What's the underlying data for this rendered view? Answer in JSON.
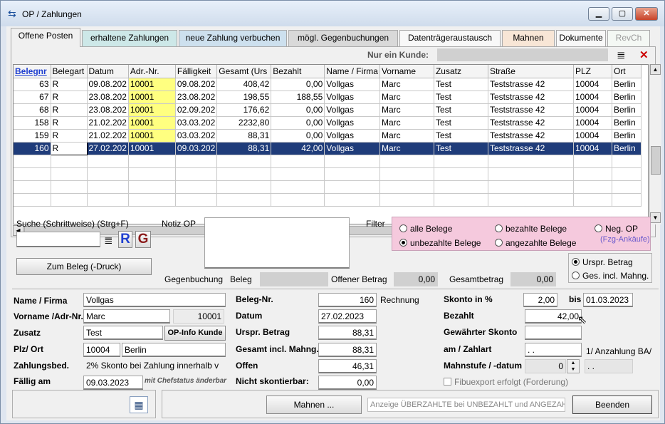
{
  "window": {
    "title": "OP / Zahlungen",
    "minimize": "▁",
    "maximize": "▢",
    "close": "✕"
  },
  "tabs": [
    {
      "label": "Offene Posten",
      "bg": "#f0f0f0"
    },
    {
      "label": "erhaltene Zahlungen",
      "bg": "#cde8e8"
    },
    {
      "label": "neue Zahlung verbuchen",
      "bg": "#cde0ee"
    },
    {
      "label": "mögl. Gegenbuchungen",
      "bg": "#d9d9d9"
    },
    {
      "label": "Datenträgeraustausch",
      "bg": "#f8f8f8"
    },
    {
      "label": "Mahnen",
      "bg": "#f8e6d6"
    },
    {
      "label": "Dokumente",
      "bg": "#f8f8f8"
    },
    {
      "label": "RevCh",
      "bg": "#f4f8f4",
      "disabled": true
    }
  ],
  "toolbar": {
    "nur_ein_kunde": "Nur ein Kunde:",
    "menu_icon": "≣",
    "close_icon": "✕"
  },
  "grid": {
    "columns": [
      "Belegnr",
      "Belegart",
      "Datum",
      "Adr.-Nr.",
      "Fälligkeit",
      "Gesamt (Urs",
      "Bezahlt",
      "Name / Firma",
      "Vorname",
      "Zusatz",
      "Straße",
      "PLZ",
      "Ort"
    ],
    "rows": [
      [
        "63",
        "R",
        "09.08.202",
        "10001",
        "09.08.202",
        "408,42",
        "0,00",
        "Vollgas",
        "Marc",
        "Test",
        "Teststrasse 42",
        "10004",
        "Berlin"
      ],
      [
        "67",
        "R",
        "23.08.202",
        "10001",
        "23.08.202",
        "198,55",
        "188,55",
        "Vollgas",
        "Marc",
        "Test",
        "Teststrasse 42",
        "10004",
        "Berlin"
      ],
      [
        "68",
        "R",
        "23.08.202",
        "10001",
        "02.09.202",
        "176,62",
        "0,00",
        "Vollgas",
        "Marc",
        "Test",
        "Teststrasse 42",
        "10004",
        "Berlin"
      ],
      [
        "158",
        "R",
        "21.02.202",
        "10001",
        "03.03.202",
        "2232,80",
        "0,00",
        "Vollgas",
        "Marc",
        "Test",
        "Teststrasse 42",
        "10004",
        "Berlin"
      ],
      [
        "159",
        "R",
        "21.02.202",
        "10001",
        "03.03.202",
        "88,31",
        "0,00",
        "Vollgas",
        "Marc",
        "Test",
        "Teststrasse 42",
        "10004",
        "Berlin"
      ],
      [
        "160",
        "R",
        "27.02.202",
        "10001",
        "09.03.202",
        "88,31",
        "42,00",
        "Vollgas",
        "Marc",
        "Test",
        "Teststrasse 42",
        "10004",
        "Berlin"
      ]
    ],
    "selected_row": 5
  },
  "search": {
    "label": "Suche (Schrittweise) (Strg+F)",
    "value": "",
    "menu_icon": "≣",
    "r_label": "R",
    "g_label": "G",
    "zum_beleg": "Zum Beleg (-Druck)"
  },
  "notiz": {
    "label": "Notiz OP",
    "value": ""
  },
  "filter": {
    "label": "Filter",
    "options": [
      "alle Belege",
      "bezahlte Belege",
      "Neg. OP",
      "unbezahlte Belege",
      "angezahlte Belege"
    ],
    "neg_note": "(Fzg-Ankäufe)",
    "selected": "unbezahlte Belege"
  },
  "betrag_mode": {
    "options": [
      "Urspr. Betrag",
      "Ges. incl. Mahng."
    ],
    "selected": "Urspr. Betrag"
  },
  "gegenbuchung": {
    "label": "Gegenbuchung",
    "beleg_label": "Beleg",
    "beleg_value": "",
    "offener_label": "Offener Betrag",
    "offener_value": "0,00",
    "gesamt_label": "Gesamtbetrag",
    "gesamt_value": "0,00"
  },
  "details": {
    "name_label": "Name / Firma",
    "name": "Vollgas",
    "vorname_label": "Vorname /Adr-Nr.",
    "vorname": "Marc",
    "adrnr": "10001",
    "zusatz_label": "Zusatz",
    "zusatz": "Test",
    "op_info": "OP-Info Kunde",
    "plz_label": "Plz/ Ort",
    "plz": "10004",
    "ort": "Berlin",
    "zahlungsbed_label": "Zahlungsbed.",
    "zahlungsbed": "2% Skonto bei Zahlung innerhalb v",
    "faellig_label": "Fällig am",
    "faellig": "09.03.2023",
    "chefstatus": "mit Chefstatus änderbar",
    "belegnr_label": "Beleg-Nr.",
    "belegnr": "160",
    "belegart": "Rechnung",
    "datum_label": "Datum",
    "datum": "27.02.2023",
    "urspr_label": "Urspr. Betrag",
    "urspr": "88,31",
    "gesamt_label": "Gesamt incl. Mahng.",
    "gesamt": "88,31",
    "offen_label": "Offen",
    "offen": "46,31",
    "nicht_label": "Nicht skontierbar:",
    "nicht": "0,00",
    "skonto_label": "Skonto in %",
    "skonto": "2,00",
    "bis_label": "bis",
    "bis": "01.03.2023",
    "bezahlt_label": "Bezahlt",
    "bezahlt": "42,00",
    "gewaehrt_label": "Gewährter Skonto",
    "gewaehrt": "",
    "zahlart_label": "am / Zahlart",
    "zahlart_date": ". .",
    "zahlart_text": "1/  Anzahlung BA/",
    "mahnstufe_label": "Mahnstufe / -datum",
    "mahnstufe": "0",
    "mahndatum": ". .",
    "fibu_label": "Fibuexport erfolgt (Forderung)"
  },
  "bottom": {
    "mahnen": "Mahnen ...",
    "anzeige": "Anzeige ÜBERZAHLTE bei UNBEZAHLT und ANGEZAHLT",
    "beenden": "Beenden",
    "calc_icon": "calculator-icon"
  }
}
